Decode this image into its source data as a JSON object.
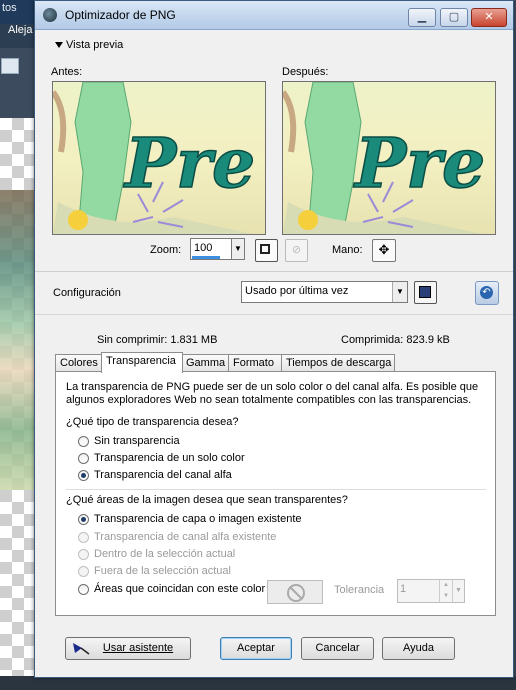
{
  "background_app": {
    "menu_fragment": "tos",
    "toolbar_fragment": "Aleja"
  },
  "dialog": {
    "title": "Optimizador de PNG",
    "window_controls": [
      "minimize",
      "maximize",
      "close"
    ],
    "preview_toggle": "Vista previa",
    "before_label": "Antes:",
    "after_label": "Después:",
    "preview_text": "Pre",
    "zoom_label": "Zoom:",
    "zoom_value": "100",
    "hand_label": "Mano:",
    "config_label": "Configuración",
    "config_value": "Usado por última vez",
    "uncompressed": "Sin comprimir:  1.831 MB",
    "compressed": "Comprimida: 823.9 kB",
    "tabs": [
      {
        "label": "Colores",
        "active": false
      },
      {
        "label": "Transparencia",
        "active": true
      },
      {
        "label": "Gamma",
        "active": false
      },
      {
        "label": "Formato",
        "active": false
      },
      {
        "label": "Tiempos de descarga",
        "active": false
      }
    ],
    "description": "La transparencia de PNG puede ser de un solo color o del canal alfa. Es posible que algunos exploradores Web no sean totalmente compatibles con las transparencias.",
    "question1": "¿Qué tipo de transparencia desea?",
    "type_options": [
      {
        "label": "Sin transparencia",
        "checked": false,
        "disabled": false
      },
      {
        "label": "Transparencia de un solo color",
        "checked": false,
        "disabled": false
      },
      {
        "label": "Transparencia del canal alfa",
        "checked": true,
        "disabled": false
      }
    ],
    "question2": "¿Qué áreas de la imagen desea que sean transparentes?",
    "area_options": [
      {
        "label": "Transparencia de capa o imagen existente",
        "checked": true,
        "disabled": false
      },
      {
        "label": "Transparencia de canal alfa existente",
        "checked": false,
        "disabled": true
      },
      {
        "label": "Dentro de la selección actual",
        "checked": false,
        "disabled": true
      },
      {
        "label": "Fuera de la selección actual",
        "checked": false,
        "disabled": true
      },
      {
        "label": "Áreas que coincidan con este color",
        "checked": false,
        "disabled": false
      }
    ],
    "tolerance_label": "Tolerancia",
    "tolerance_value": "1",
    "buttons": {
      "wizard": "Usar asistente",
      "ok": "Aceptar",
      "cancel": "Cancelar",
      "help": "Ayuda"
    },
    "colors": {
      "title_gradient": "#c4d7ee",
      "preview_text": "#1a8a7a",
      "dress": "#8fd7a0"
    }
  }
}
